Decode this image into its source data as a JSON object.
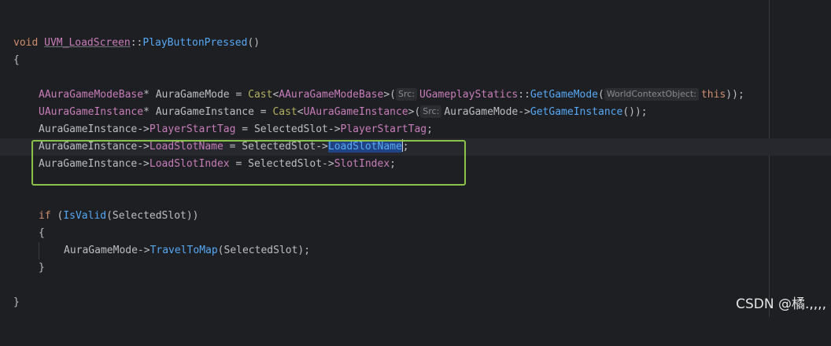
{
  "code": {
    "sig_void": "void",
    "sig_class": "UVM_LoadScreen",
    "sig_sep": "::",
    "sig_fn": "PlayButtonPressed",
    "sig_parens": "()",
    "open_brace": "{",
    "l1_type": "AAuraGameModeBase",
    "l1_ptr": "* AuraGameMode = ",
    "l1_cast": "Cast",
    "l1_lt": "<",
    "l1_targ": "AAuraGameModeBase",
    "l1_gt": ">(",
    "l1_hint": "Src:",
    "l1_class": "UGameplayStatics",
    "l1_sep": "::",
    "l1_fn": "GetGameMode",
    "l1_paren": "(",
    "l1_hint2": "WorldContextObject:",
    "l1_this": "this",
    "l1_end": "));",
    "l2_type": "UAuraGameInstance",
    "l2_ptr": "* AuraGameInstance = ",
    "l2_cast": "Cast",
    "l2_lt": "<",
    "l2_targ": "UAuraGameInstance",
    "l2_gt": ">(",
    "l2_hint": "Src:",
    "l2_obj": "AuraGameMode->",
    "l2_fn": "GetGameInstance",
    "l2_end": "());",
    "l3_obj": "AuraGameInstance->",
    "l3_mem": "PlayerStartTag",
    "l3_mid": " = SelectedSlot->",
    "l3_mem2": "PlayerStartTag",
    "l3_end": ";",
    "l4_obj": "AuraGameInstance->",
    "l4_mem": "LoadSlotName",
    "l4_mid": " = SelectedSlot->",
    "l4_mem2": "LoadSlotName",
    "l4_end": ";",
    "l5_obj": "AuraGameInstance->",
    "l5_mem": "LoadSlotIndex",
    "l5_mid": " = SelectedSlot->",
    "l5_mem2": "SlotIndex",
    "l5_end": ";",
    "if_kw": "if",
    "if_open": " (",
    "if_fn": "IsValid",
    "if_args": "(SelectedSlot))",
    "inner_open": "{",
    "travel_obj": "AuraGameMode->",
    "travel_fn": "TravelToMap",
    "travel_args": "(SelectedSlot);",
    "inner_close": "}",
    "close_brace": "}"
  },
  "watermark": "CSDN @橘.,,,,"
}
